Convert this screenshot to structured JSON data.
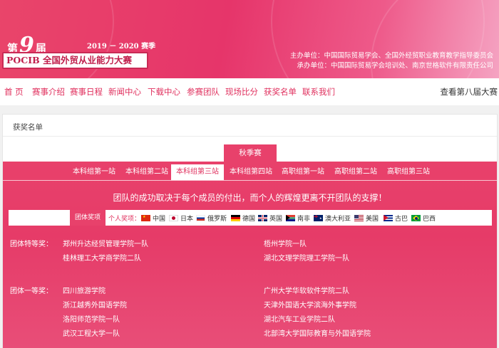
{
  "header": {
    "edition_prefix": "第",
    "edition_number": "9",
    "edition_suffix": "届",
    "season": "2019 － 2020 赛季",
    "title": "POCIB 全国外贸从业能力大赛",
    "organizer": "主办单位：中国国际贸易学会、全国外经贸职业教育教学指导委员会",
    "undertaker": "承办单位：中国国际贸易学会培训处、南京世格软件有限责任公司"
  },
  "nav": {
    "items": [
      "首 页",
      "赛事介绍",
      "赛事日程",
      "新闻中心",
      "下载中心",
      "参赛团队",
      "现场比分",
      "获奖名单",
      "联系我们"
    ],
    "right": "查看第八届大赛"
  },
  "content": {
    "breadcrumb": "获奖名单",
    "season_tab": "秋季赛",
    "subtabs": [
      "本科组第一站",
      "本科组第二站",
      "本科组第三站",
      "本科组第四站",
      "高职组第一站",
      "高职组第二站",
      "高职组第三站"
    ],
    "active_subtab": 2,
    "motto": "团队的成功取决于每个成员的付出，而个人的辉煌更离不开团队的支撑！",
    "filter": {
      "team_label": "团体奖项",
      "individual_label": "个人奖项：",
      "countries": [
        "中国",
        "日本",
        "俄罗斯",
        "德国",
        "英国",
        "南非",
        "澳大利亚",
        "美国",
        "古巴",
        "巴西"
      ]
    },
    "prizes": [
      {
        "label": "团体特等奖：",
        "left": [
          "郑州升达经贸管理学院一队",
          "桂林理工大学商学院二队"
        ],
        "right": [
          "梧州学院一队",
          "湖北文理学院理工学院一队"
        ]
      },
      {
        "label": "团体一等奖：",
        "left": [
          "四川旅游学院",
          "浙江越秀外国语学院",
          "洛阳师范学院一队",
          "武汉工程大学一队"
        ],
        "right": [
          "广州大学华软软件学院二队",
          "天津外国语大学滨海外事学院",
          "湖北汽车工业学院二队",
          "北部湾大学国际教育与外国语学院"
        ]
      }
    ]
  }
}
